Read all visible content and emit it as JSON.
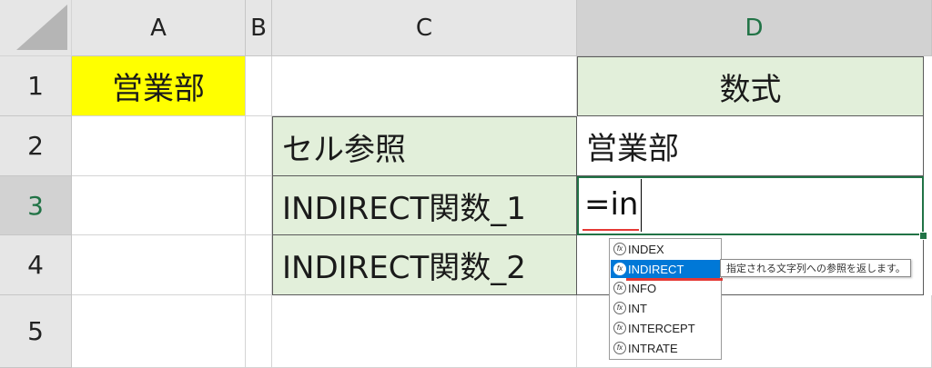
{
  "sheet": {
    "columns": [
      "A",
      "B",
      "C",
      "D"
    ],
    "rows": [
      "1",
      "2",
      "3",
      "4",
      "5"
    ],
    "selected_column": "D",
    "selected_row": "3",
    "cells": {
      "A1": "営業部",
      "D1": "数式",
      "C2": "セル参照",
      "D2": "営業部",
      "C3": "INDIRECT関数_1",
      "C4": "INDIRECT関数_2"
    },
    "editing_value": "=in"
  },
  "autocomplete": {
    "items": [
      "INDEX",
      "INDIRECT",
      "INFO",
      "INT",
      "INTERCEPT",
      "INTRATE"
    ],
    "selected": "INDIRECT",
    "icon_label": "fx",
    "tooltip": "指定される文字列への参照を返します。"
  },
  "colors": {
    "header_bg": "#e6e6e6",
    "selected_header_text": "#217346",
    "highlight_yellow": "#ffff00",
    "table_green": "#e2efda",
    "selection_blue": "#0078d7",
    "underline_red": "#e53935"
  }
}
